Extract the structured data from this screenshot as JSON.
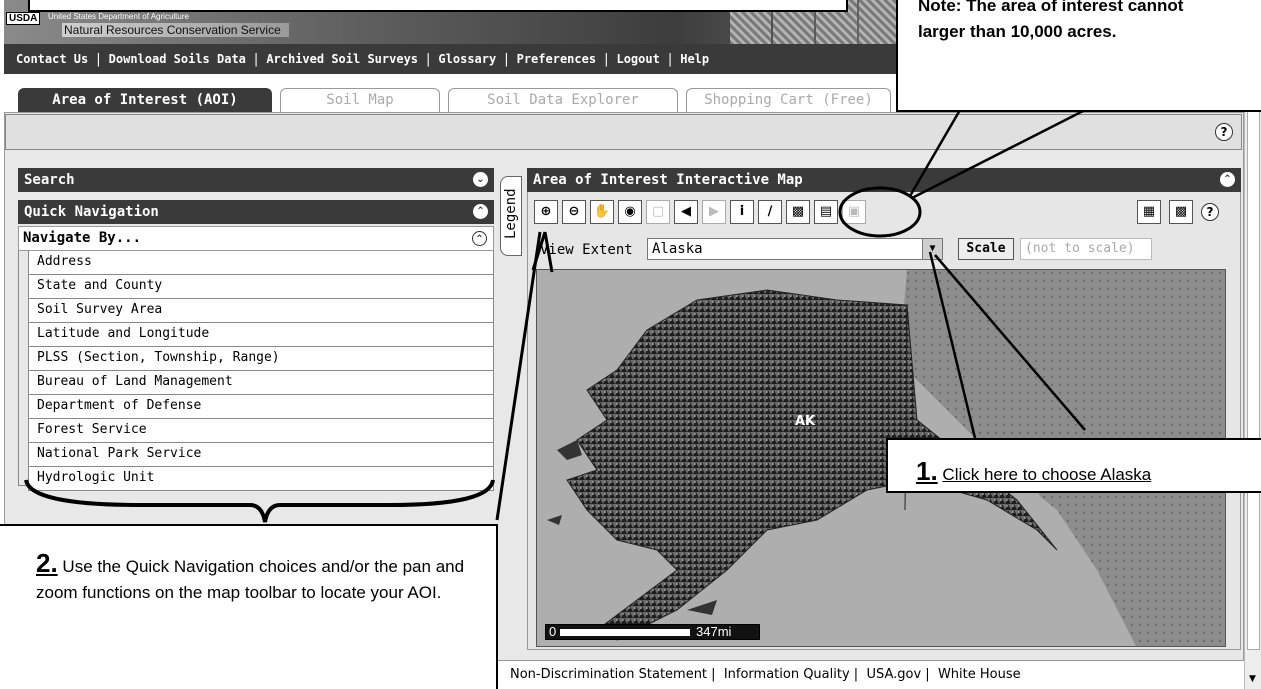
{
  "header": {
    "usda_logo": "USDA",
    "department": "United States Department of Agriculture",
    "agency": "Natural Resources Conservation Service"
  },
  "topnav": {
    "items": [
      "Contact Us",
      "Download Soils Data",
      "Archived Soil Surveys",
      "Glossary",
      "Preferences",
      "Logout",
      "Help"
    ]
  },
  "tabs": {
    "items": [
      "Area of Interest (AOI)",
      "Soil Map",
      "Soil Data Explorer",
      "Shopping Cart (Free)"
    ],
    "active": "Area of Interest (AOI)"
  },
  "left_panel": {
    "search_title": "Search",
    "quick_nav_title": "Quick Navigation",
    "navigate_by_title": "Navigate By...",
    "items": [
      "Address",
      "State and County",
      "Soil Survey Area",
      "Latitude and Longitude",
      "PLSS (Section, Township, Range)",
      "Bureau of Land Management",
      "Department of Defense",
      "Forest Service",
      "National Park Service",
      "Hydrologic Unit"
    ]
  },
  "map_panel": {
    "legend_label": "Legend",
    "title": "Area of Interest Interactive Map",
    "view_extent_label": "View Extent",
    "view_extent_value": "Alaska",
    "scale_button": "Scale",
    "scale_value": "(not to scale)",
    "map_label": "AK",
    "scale_zero": "0",
    "scale_distance": "347mi",
    "toolbar_icons": [
      "zoom-in-icon",
      "zoom-out-icon",
      "pan-icon",
      "full-extent-icon",
      "aoi-icon",
      "back-icon",
      "forward-icon",
      "identify-icon",
      "measure-icon",
      "aoi-rectangle-icon",
      "aoi-polygon-icon",
      "clear-aoi-icon"
    ]
  },
  "footer": {
    "links": [
      "Non-Discrimination Statement",
      "Information Quality",
      "USA.gov",
      "White House"
    ]
  },
  "annotations": {
    "note_line1": "Note:  The area of interest cannot",
    "note_line2": "larger than 10,000 acres.",
    "callout1_num": "1.",
    "callout1_text": "Click here to choose Alaska",
    "callout2_num": "2.",
    "callout2_text": "Use the Quick Navigation choices and/or the pan and zoom functions on the map toolbar to locate your AOI."
  },
  "colors": {
    "header_dark": "#3a3a3a",
    "panel_bg": "#e0e0e0",
    "map_water": "#aeaeae"
  }
}
